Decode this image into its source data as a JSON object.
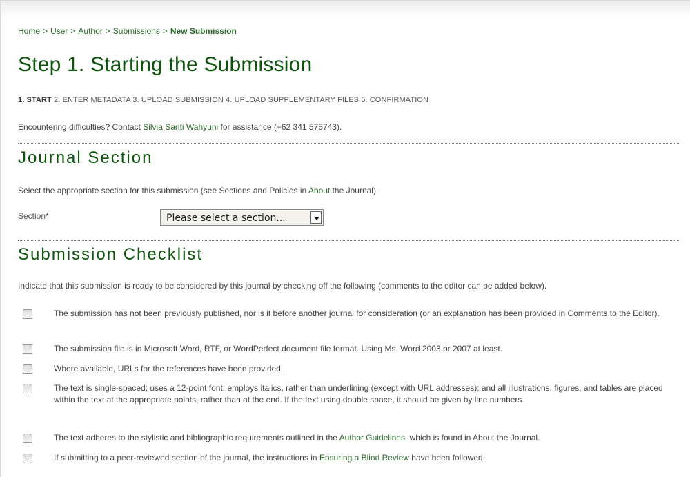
{
  "breadcrumb": {
    "home": "Home",
    "user": "User",
    "author": "Author",
    "submissions": "Submissions",
    "current": "New Submission",
    "separator": ">"
  },
  "page_title": "Step 1. Starting the Submission",
  "steps": {
    "active": "1. START",
    "rest": " 2. ENTER METADATA 3. UPLOAD SUBMISSION 4. UPLOAD SUPPLEMENTARY FILES 5. CONFIRMATION"
  },
  "contact": {
    "prefix": "Encountering difficulties? Contact ",
    "name": "Silvia Santi Wahyuni",
    "suffix": " for assistance (+62 341 575743)."
  },
  "journal_section": {
    "heading": "Journal Section",
    "instruction_prefix": "Select the appropriate section for this submission (see Sections and Policies in ",
    "instruction_link": "About",
    "instruction_suffix": " the Journal).",
    "section_label": "Section*",
    "section_select_value": "Please select a section..."
  },
  "checklist": {
    "heading": "Submission Checklist",
    "instruction": "Indicate that this submission is ready to be considered by this journal by checking off the following (comments to the editor can be added below).",
    "items": [
      {
        "text": "The submission has not been previously published, nor is it before another journal for consideration (or an explanation has been provided in Comments to the Editor).",
        "checked": false
      },
      {
        "text": "The submission file is in Microsoft Word, RTF, or WordPerfect document file format. Using Ms. Word 2003 or 2007 at least.",
        "checked": false
      },
      {
        "text": "Where available, URLs for the references have been provided.",
        "checked": false
      },
      {
        "text": "The text is single-spaced; uses a 12-point font; employs italics, rather than underlining (except with URL addresses); and all illustrations, figures, and tables are placed within the text at the appropriate points, rather than at the end. If the text using double space, it should be given by line numbers.",
        "checked": false
      },
      {
        "prefix": "The text adheres to the stylistic and bibliographic requirements outlined in the ",
        "link": "Author Guidelines",
        "suffix": ", which is found in About the Journal.",
        "checked": false
      },
      {
        "prefix": "If submitting to a peer-reviewed section of the journal, the instructions in ",
        "link": "Ensuring a Blind Review",
        "suffix": " have been followed.",
        "checked": false
      }
    ]
  },
  "colors": {
    "heading": "#0e550e",
    "link": "#2a6a2a",
    "text": "#444444"
  }
}
